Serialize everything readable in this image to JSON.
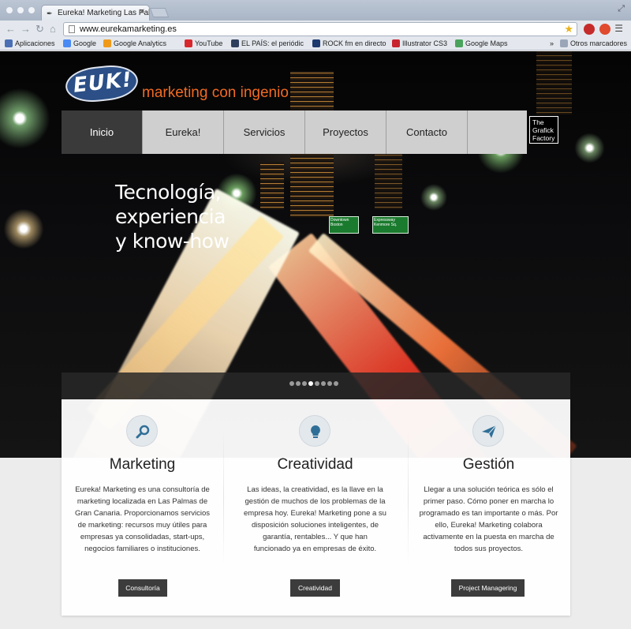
{
  "browser": {
    "tab_title": "Eureka! Marketing Las Pal",
    "url": "www.eurekamarketing.es",
    "bookmarks": [
      {
        "label": "Aplicaciones",
        "color": "#4a6fb5"
      },
      {
        "label": "Google",
        "color": "#4a8af4"
      },
      {
        "label": "Google Analytics",
        "color": "#f09a1a"
      },
      {
        "label": "YouTube",
        "color": "#d9272e"
      },
      {
        "label": "EL PAÍS: el periódic",
        "color": "#2d3e5c"
      },
      {
        "label": "ROCK fm en directo",
        "color": "#1d3a6e"
      },
      {
        "label": "Illustrator CS3",
        "color": "#c8242f"
      },
      {
        "label": "Google Maps",
        "color": "#4aa35c"
      }
    ],
    "bookmarks_overflow": "»",
    "other_bookmarks": "Otros marcadores"
  },
  "site": {
    "logo_text": "EUK!",
    "slogan": "marketing con ingenio",
    "menu": [
      "Inicio",
      "Eureka!",
      "Servicios",
      "Proyectos",
      "Contacto"
    ],
    "partner_logo": "The Grafick Factory",
    "tagline_lines": [
      "Tecnología,",
      "experiencia",
      "y know-how"
    ],
    "slider_dots": 8,
    "slider_active": 3
  },
  "columns": [
    {
      "icon": "magnifier-icon",
      "title": "Marketing",
      "text": "Eureka! Marketing es una consultoría de marketing localizada en Las Palmas de Gran Canaria. Proporcionamos servicios de marketing: recursos muy útiles para empresas ya consolidadas, start-ups, negocios familiares o instituciones.",
      "button": "Consultoría"
    },
    {
      "icon": "lightbulb-icon",
      "title": "Creatividad",
      "text": "Las ideas, la creatividad, es la llave en la gestión de muchos de los problemas de la empresa hoy. Eureka! Marketing pone a su disposición soluciones inteligentes, de garantía, rentables... Y que han funcionado ya en empresas de éxito.",
      "button": "Creatividad"
    },
    {
      "icon": "paper-plane-icon",
      "title": "Gestión",
      "text": "Llegar a una solución teórica es sólo el primer paso. Cómo poner en marcha lo programado es tan importante o más. Por ello, Eureka! Marketing colabora activamente en la puesta en marcha de todos sus proyectos.",
      "button": "Project Managering"
    }
  ],
  "signs": [
    "Downtown Boston",
    "Expressway Kenmore Sq."
  ]
}
